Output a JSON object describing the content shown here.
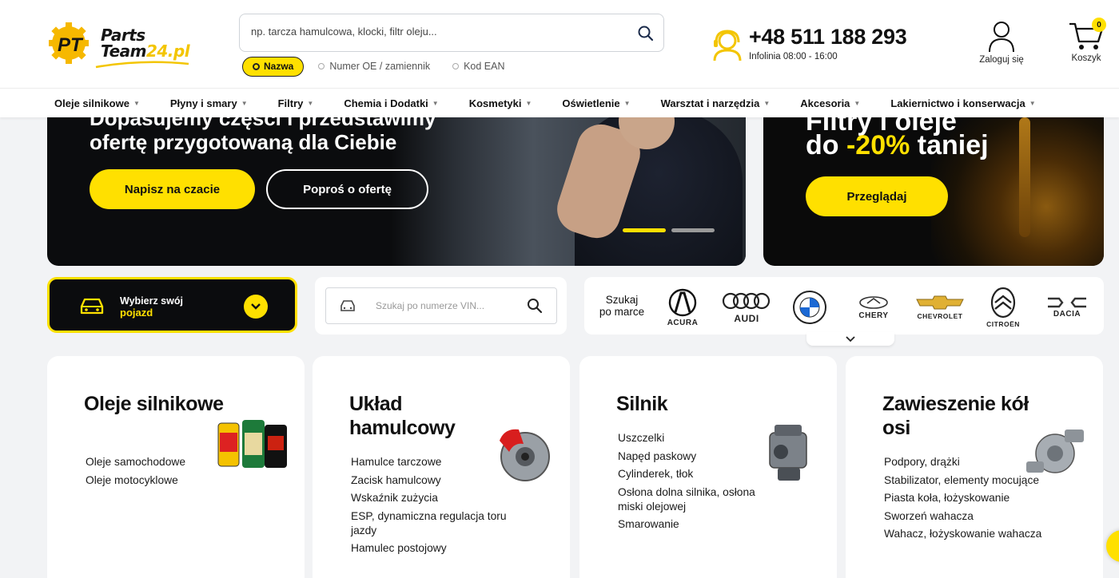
{
  "logo": {
    "word1": "Parts",
    "word2_a": "Team",
    "word2_b": "24.pl",
    "mark": "PT"
  },
  "search": {
    "placeholder": "np. tarcza hamulcowa, klocki, filtr oleju...",
    "options": [
      "Nazwa",
      "Numer OE / zamiennik",
      "Kod EAN"
    ],
    "active_option": "Nazwa"
  },
  "contact": {
    "phone": "+48 511 188 293",
    "hours": "Infolinia 08:00 - 16:00"
  },
  "account": {
    "label": "Zaloguj się"
  },
  "cart": {
    "label": "Koszyk",
    "count": "0"
  },
  "nav": {
    "items": [
      "Oleje silnikowe",
      "Płyny i smary",
      "Filtry",
      "Chemia i Dodatki",
      "Kosmetyki",
      "Oświetlenie",
      "Warsztat i narzędzia",
      "Akcesoria",
      "Lakiernictwo i konserwacja"
    ]
  },
  "banner_main": {
    "line_partial": "Dopasujemy części i przedstawimy",
    "line": "ofertę przygotowaną dla Ciebie",
    "btn_chat": "Napisz na czacie",
    "btn_offer": "Poproś o ofertę"
  },
  "banner_side": {
    "line_partial": "Filtry i oleje",
    "pre": "do ",
    "pct": "-20%",
    "post": " taniej",
    "btn": "Przeglądaj"
  },
  "vehicle": {
    "line1": "Wybierz swój",
    "line2": "pojazd"
  },
  "vin": {
    "placeholder": "Szukaj po numerze VIN..."
  },
  "brands": {
    "label_1": "Szukaj",
    "label_2": "po marce",
    "items": [
      "ACURA",
      "AUDI",
      "BMW",
      "CHERY",
      "CHEVROLET",
      "CITROËN",
      "DACIA"
    ]
  },
  "categories": [
    {
      "title": "Oleje silnikowe",
      "items": [
        "Oleje samochodowe",
        "Oleje motocyklowe"
      ]
    },
    {
      "title": "Układ hamulcowy",
      "items": [
        "Hamulce tarczowe",
        "Zacisk hamulcowy",
        "Wskaźnik zużycia",
        "ESP, dynamiczna regulacja toru jazdy",
        "Hamulec postojowy"
      ]
    },
    {
      "title": "Silnik",
      "items": [
        "Uszczelki",
        "Napęd paskowy",
        "Cylinderek, tłok",
        "Osłona dolna silnika, osłona miski olejowej",
        "Smarowanie"
      ]
    },
    {
      "title": "Zawieszenie kół osi",
      "items": [
        "Podpory, drążki",
        "Stabilizator, elementy mocujące",
        "Piasta koła, łożyskowanie",
        "Sworzeń wahacza",
        "Wahacz, łożyskowanie wahacza"
      ]
    }
  ],
  "colors": {
    "accent": "#ffe000",
    "dark": "#0b0c0e",
    "background": "#f2f3f5"
  },
  "icons": [
    "search-icon",
    "phone-support-icon",
    "user-icon",
    "cart-icon",
    "car-icon",
    "chevron-down-icon"
  ]
}
